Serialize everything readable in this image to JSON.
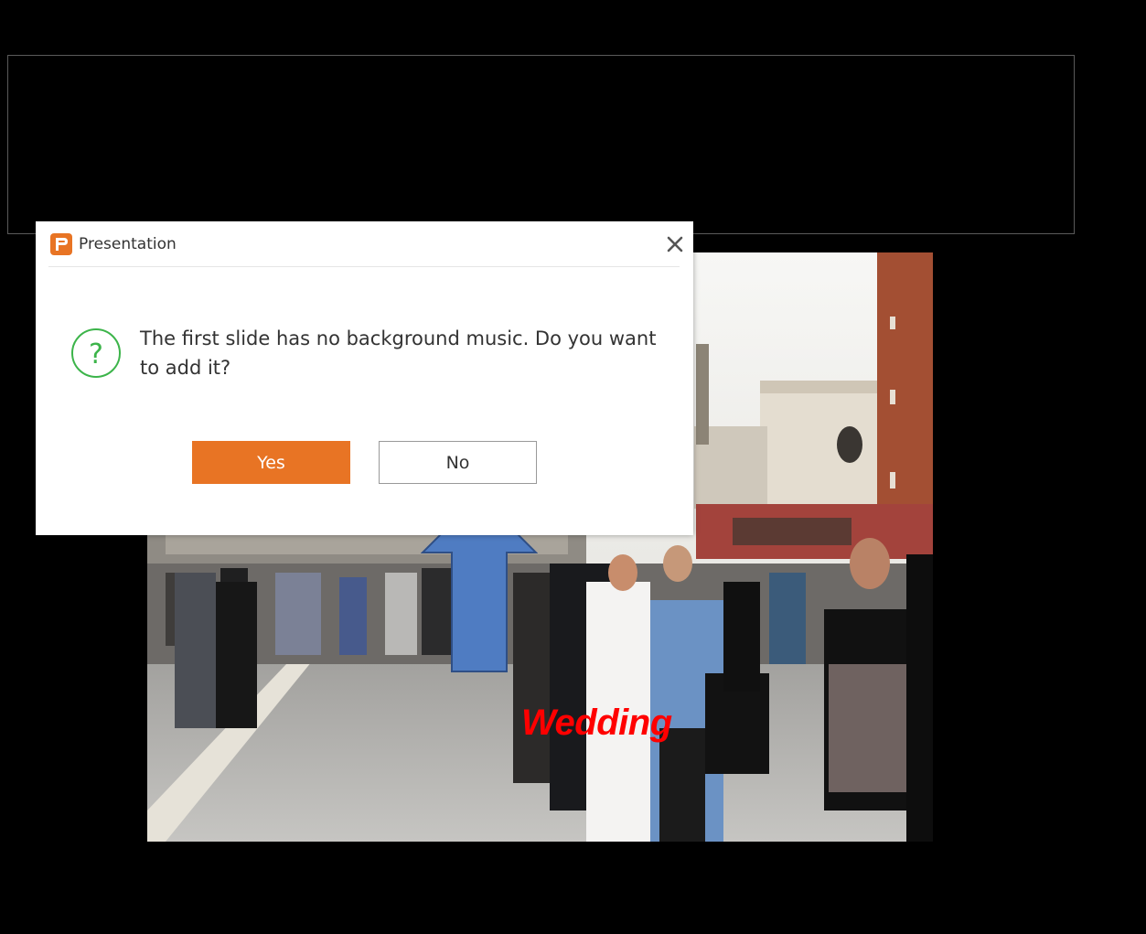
{
  "dialog": {
    "title": "Presentation",
    "message": "The first slide has no background music. Do you want to add it?",
    "yes_label": "Yes",
    "no_label": "No",
    "icons": {
      "app": "presentation-app-icon",
      "close": "close-icon",
      "question": "question-icon"
    }
  },
  "slide": {
    "caption": "Wedding"
  },
  "colors": {
    "accent": "#e87424",
    "question_icon": "#3cb44a",
    "annotation_arrow": "#4f7cc2",
    "caption": "#ff0000"
  }
}
